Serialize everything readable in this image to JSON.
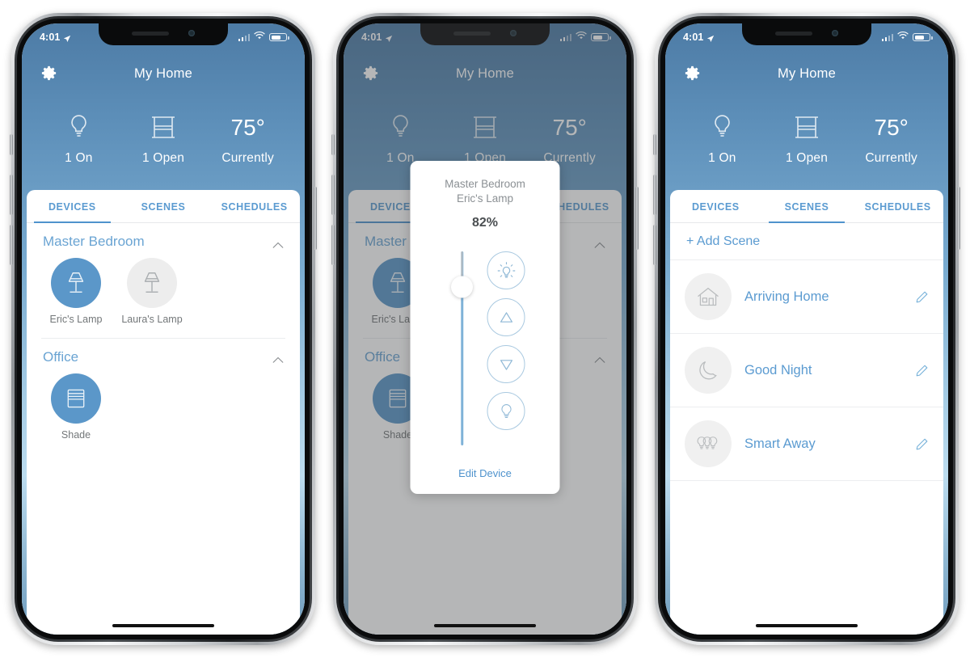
{
  "app": {
    "title": "My Home",
    "accent": "#4f93cd",
    "icon_gear": "gear-icon"
  },
  "status_bar": {
    "time": "4:01",
    "location_icon": "location-arrow-icon",
    "signal_icon": "cellular-signal-icon",
    "wifi_icon": "wifi-icon",
    "battery_icon": "battery-icon"
  },
  "summary": [
    {
      "icon": "lightbulb-icon",
      "value": "",
      "label": "1 On"
    },
    {
      "icon": "window-shade-icon",
      "value": "",
      "label": "1 Open"
    },
    {
      "icon": "temperature-value",
      "value": "75°",
      "label": "Currently"
    }
  ],
  "tabs": [
    {
      "label": "DEVICES"
    },
    {
      "label": "SCENES"
    },
    {
      "label": "SCHEDULES"
    }
  ],
  "screens": {
    "devices": {
      "active_tab": "DEVICES",
      "groups": [
        {
          "name": "Master Bedroom",
          "collapse_icon": "chevron-up-icon",
          "devices": [
            {
              "name": "Eric's Lamp",
              "icon": "table-lamp-icon",
              "state": "on"
            },
            {
              "name": "Laura's Lamp",
              "icon": "table-lamp-icon",
              "state": "off"
            }
          ]
        },
        {
          "name": "Office",
          "collapse_icon": "chevron-up-icon",
          "devices": [
            {
              "name": "Shade",
              "icon": "window-shade-icon",
              "state": "on"
            }
          ]
        }
      ]
    },
    "dimmer_modal": {
      "room": "Master Bedroom",
      "device": "Eric's Lamp",
      "percent": "82%",
      "slider_value": 82,
      "controls": [
        {
          "icon": "bright-bulb-icon",
          "name": "full-bright-button"
        },
        {
          "icon": "triangle-up-icon",
          "name": "raise-button"
        },
        {
          "icon": "triangle-down-icon",
          "name": "lower-button"
        },
        {
          "icon": "dim-bulb-icon",
          "name": "off-button"
        }
      ],
      "footer_link": "Edit Device"
    },
    "scenes": {
      "active_tab": "SCENES",
      "add_label": "+ Add Scene",
      "items": [
        {
          "name": "Arriving Home",
          "icon": "house-icon",
          "edit_icon": "pencil-icon"
        },
        {
          "name": "Good Night",
          "icon": "moon-icon",
          "edit_icon": "pencil-icon"
        },
        {
          "name": "Smart Away",
          "icon": "three-bulbs-icon",
          "edit_icon": "pencil-icon"
        }
      ]
    }
  }
}
